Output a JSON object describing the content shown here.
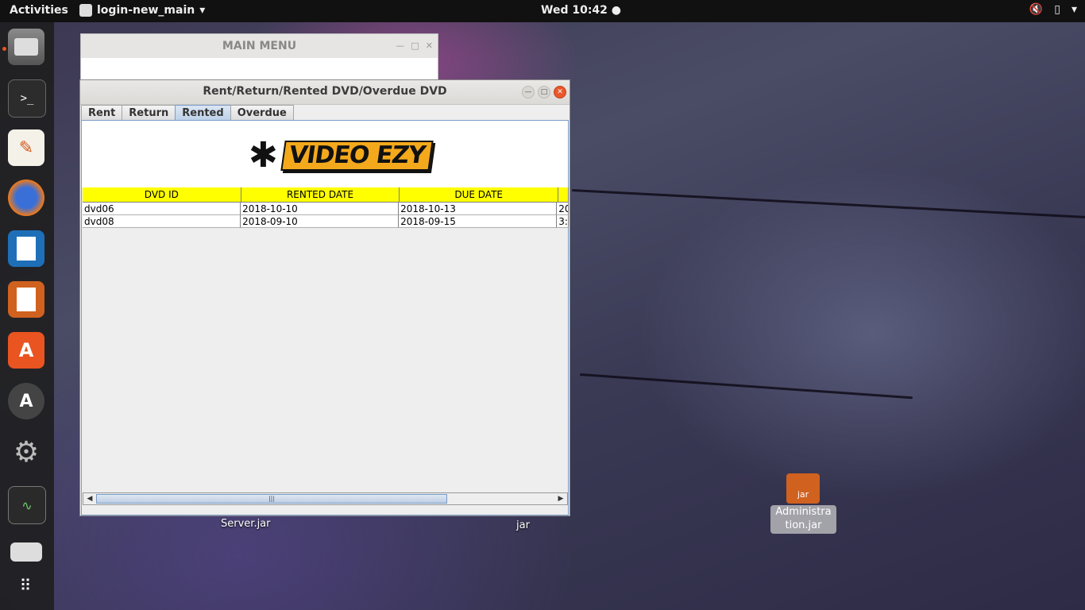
{
  "topbar": {
    "activities": "Activities",
    "app_menu": "login-new_main",
    "clock": "Wed 10:42"
  },
  "desktop": {
    "server_jar": "Server.jar",
    "partial_jar": "jar",
    "admin_jar_badge": "jar",
    "admin_jar_label": "Administra tion.jar"
  },
  "main_menu_window": {
    "title": "MAIN MENU"
  },
  "window": {
    "title": "Rent/Return/Rented DVD/Overdue DVD",
    "tabs": [
      "Rent",
      "Return",
      "Rented",
      "Overdue"
    ],
    "active_tab": "Rented",
    "logo_text": "VIDEO EZY",
    "table": {
      "headers": [
        "DVD ID",
        "RENTED DATE",
        "DUE DATE",
        ""
      ],
      "rows": [
        [
          "dvd06",
          "2018-10-10",
          "2018-10-13",
          "20"
        ],
        [
          "dvd08",
          "2018-09-10",
          "2018-09-15",
          "3:"
        ]
      ]
    }
  },
  "colors": {
    "table_header": "#ffff00",
    "accent": "#e95420"
  }
}
